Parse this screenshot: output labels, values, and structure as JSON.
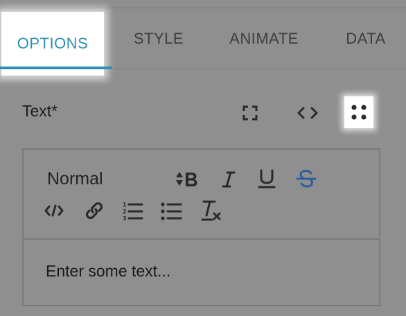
{
  "tabs": [
    {
      "label": "OPTIONS",
      "active": true
    },
    {
      "label": "STYLE",
      "active": false
    },
    {
      "label": "ANIMATE",
      "active": false
    },
    {
      "label": "DATA",
      "active": false
    }
  ],
  "field": {
    "label": "Text*",
    "actions": [
      "fullscreen-icon",
      "code-icon",
      "drag-dots-icon"
    ]
  },
  "editor": {
    "format_select": {
      "value": "Normal"
    },
    "toolbar_row1": [
      "bold-icon",
      "italic-icon",
      "underline-icon",
      "strikethrough-icon"
    ],
    "toolbar_row2": [
      "code-block-icon",
      "link-icon",
      "ordered-list-icon",
      "bullet-list-icon",
      "clear-format-icon"
    ],
    "placeholder": "Enter some text..."
  },
  "colors": {
    "accent": "#2c8fb3",
    "background": "#8f8f8f",
    "strike_icon": "#2f5d9a"
  }
}
